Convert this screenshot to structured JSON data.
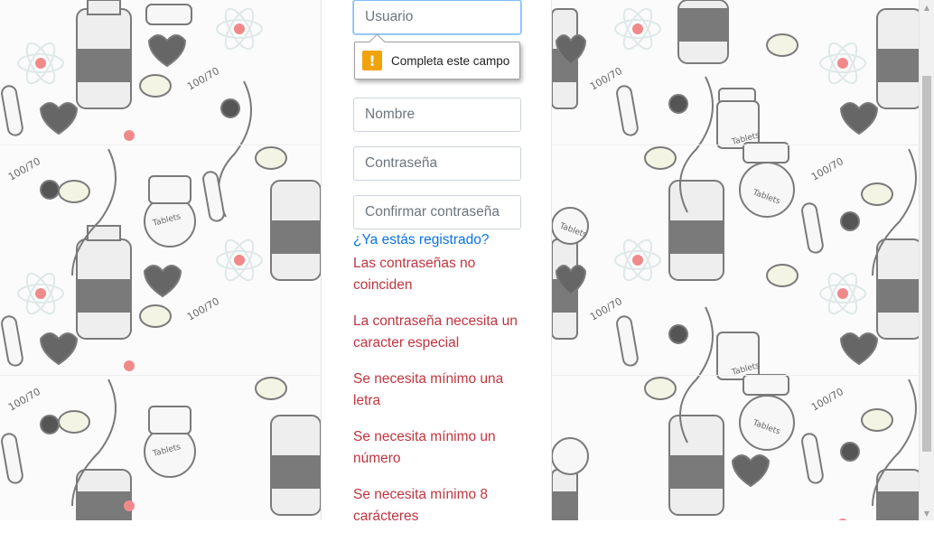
{
  "form": {
    "username_placeholder": "Usuario",
    "name_placeholder": "Nombre",
    "password_placeholder": "Contraseña",
    "confirm_password_placeholder": "Confirmar contraseña",
    "already_registered_link": "¿Ya estás registrado?"
  },
  "validation_tooltip": {
    "icon": "warning-icon",
    "text": "Completa este campo"
  },
  "errors": [
    "Las contraseñas no coinciden",
    "La contraseña necesita un caracter especial",
    "Se necesita mínimo una letra",
    "Se necesita mínimo un número",
    "Se necesita mínimo 8 carácteres"
  ],
  "colors": {
    "link": "#0b73e0",
    "error": "#c0353f",
    "tooltip_icon": "#f0a30a",
    "focus_border": "#80bdff"
  },
  "background": {
    "pattern_icons": [
      "medicine-bottle-icon",
      "stethoscope-icon",
      "heart-icon",
      "pill-icon",
      "atom-icon",
      "test-tube-icon",
      "tablets-jar-icon",
      "blood-pressure-heart-icon"
    ],
    "pattern_text": [
      "100/70",
      "Tablets"
    ]
  }
}
